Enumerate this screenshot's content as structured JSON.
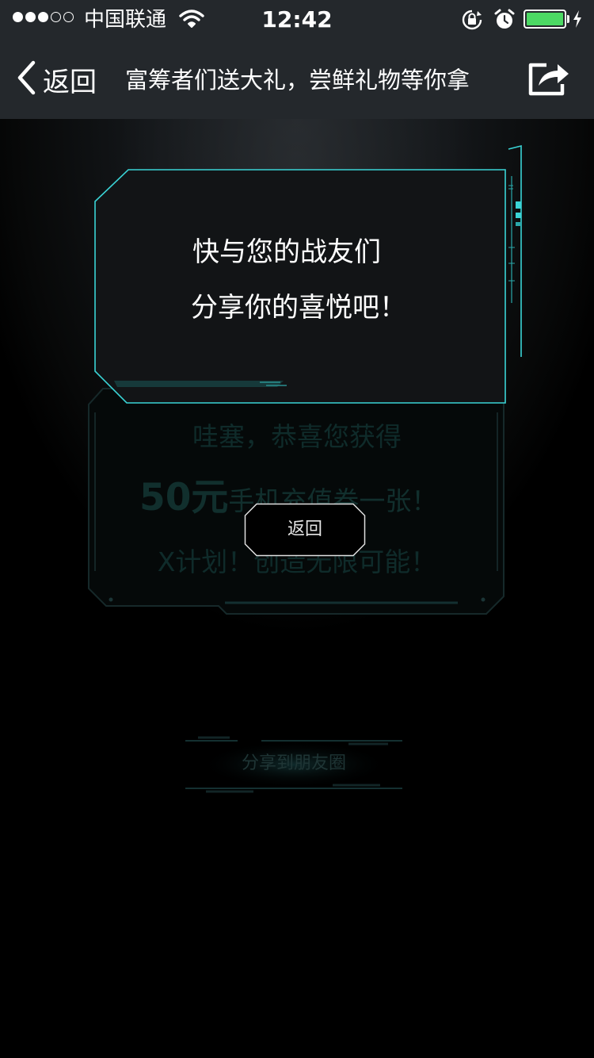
{
  "status_bar": {
    "carrier": "中国联通",
    "time": "12:42",
    "signal_bars_filled": 3,
    "signal_bars_total": 5,
    "battery_level": 1.0,
    "icons": [
      "wifi-icon",
      "rotation-lock-icon",
      "alarm-icon",
      "battery-icon",
      "charging-bolt-icon"
    ]
  },
  "nav": {
    "back_label": "返回",
    "title": "富筹者们送大礼，尝鲜礼物等你拿",
    "share_icon": "share-icon"
  },
  "dialog": {
    "line1": "快与您的战友们",
    "line2": "分享你的喜悦吧！"
  },
  "prize_card": {
    "line1": "哇塞，恭喜您获得",
    "amount": "50元",
    "line2_rest": "手机充值券一张！",
    "line3": "X计划！创造无限可能！"
  },
  "return_button": {
    "label": "返回"
  },
  "share_moments_button": {
    "label": "分享到朋友圈"
  },
  "colors": {
    "bar_bg": "#24282c",
    "accent_cyan": "#3ad4d6",
    "battery_green": "#4cd964",
    "page_bg": "#000000"
  }
}
